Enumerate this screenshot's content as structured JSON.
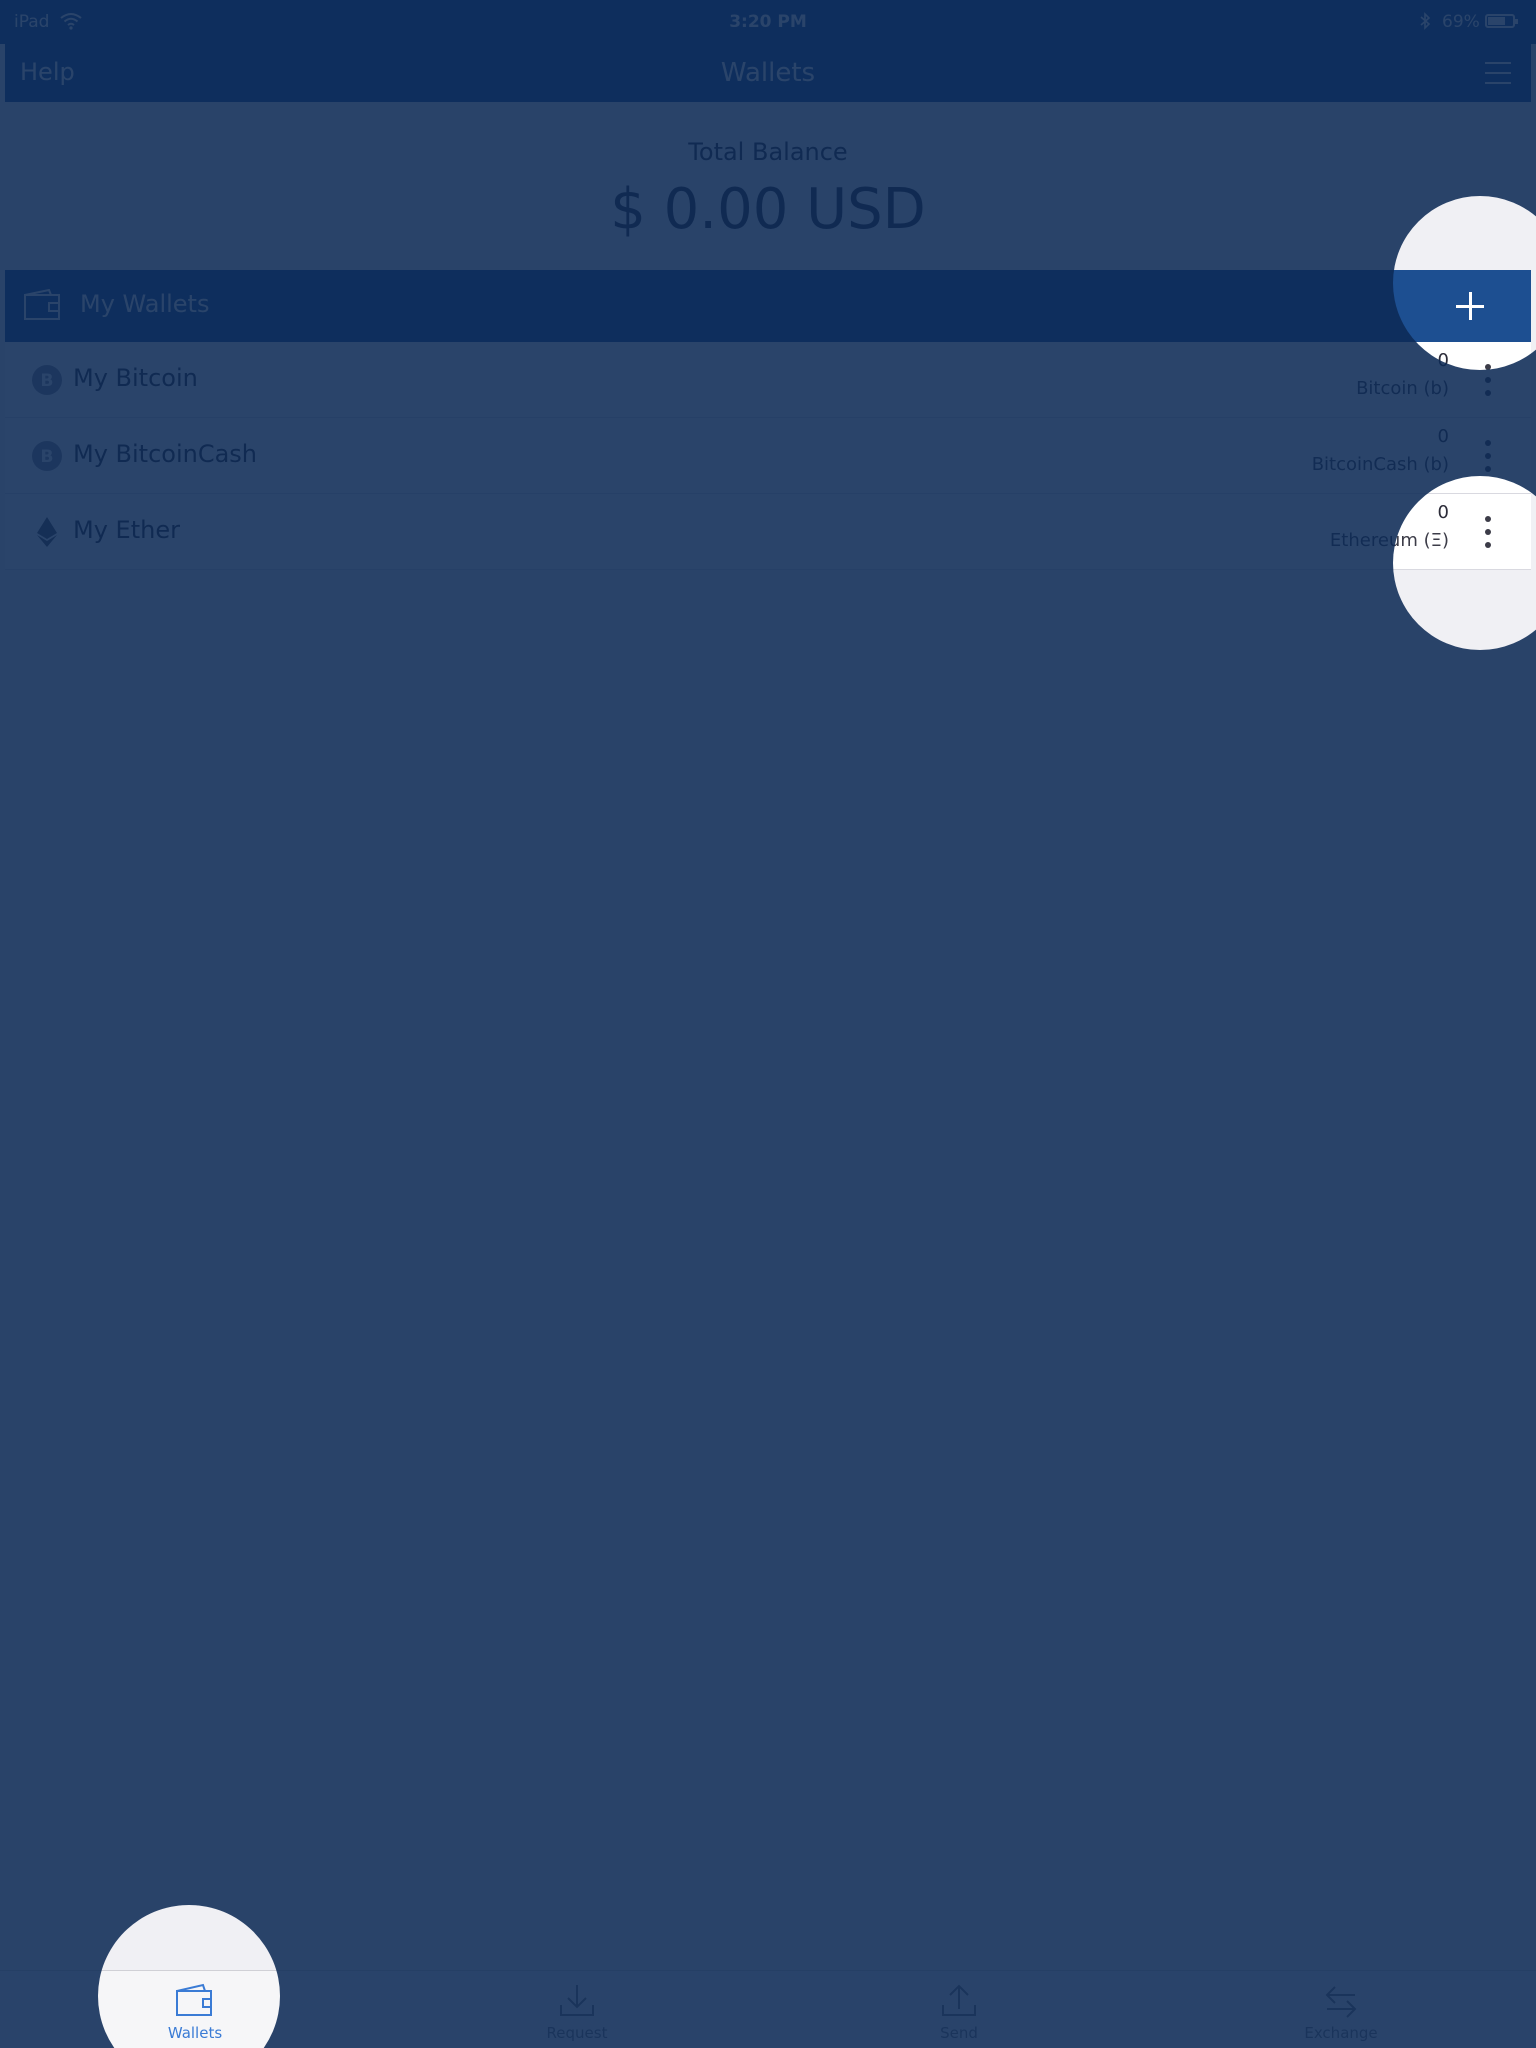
{
  "status_bar": {
    "device": "iPad",
    "time": "3:20 PM",
    "battery": "69%",
    "battery_level": 0.69
  },
  "navbar": {
    "help_label": "Help",
    "title": "Wallets"
  },
  "balance": {
    "label": "Total Balance",
    "value": "$ 0.00 USD"
  },
  "wallets_section": {
    "header_label": "My Wallets",
    "items": [
      {
        "name": "My Bitcoin",
        "amount": "0",
        "unit": "Bitcoin (b)",
        "icon": "bitcoin-icon"
      },
      {
        "name": "My BitcoinCash",
        "amount": "0",
        "unit": "BitcoinCash (b)",
        "icon": "bitcoin-cash-icon"
      },
      {
        "name": "My Ether",
        "amount": "0",
        "unit": "Ethereum (Ξ)",
        "icon": "ether-icon"
      }
    ]
  },
  "tabs": [
    {
      "label": "Wallets",
      "icon": "wallet-icon",
      "active": true
    },
    {
      "label": "Request",
      "icon": "download-icon",
      "active": false
    },
    {
      "label": "Send",
      "icon": "upload-icon",
      "active": false
    },
    {
      "label": "Exchange",
      "icon": "exchange-icon",
      "active": false
    }
  ],
  "colors": {
    "brand": "#1d4f91",
    "overlay": "#0d2a55",
    "spotlight": "#e8e7ee",
    "accent": "#3a7bd5"
  }
}
